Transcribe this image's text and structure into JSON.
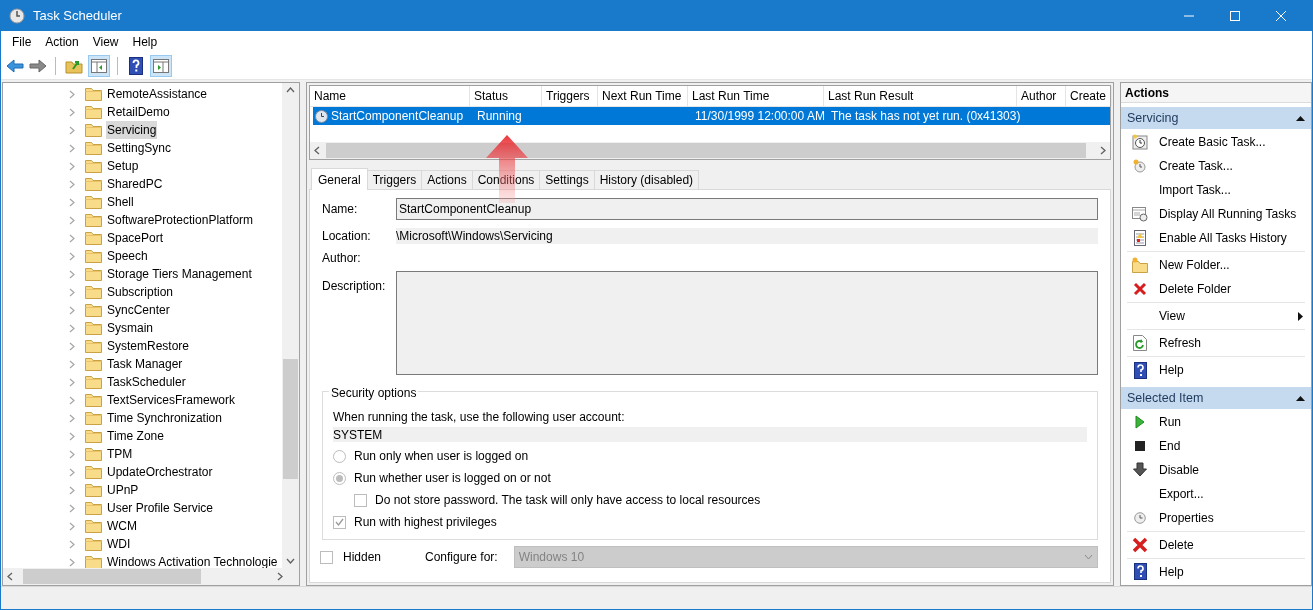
{
  "window": {
    "title": "Task Scheduler"
  },
  "menu": [
    "File",
    "Action",
    "View",
    "Help"
  ],
  "tree": {
    "items": [
      {
        "label": "RemoteAssistance",
        "selected": false
      },
      {
        "label": "RetailDemo",
        "selected": false
      },
      {
        "label": "Servicing",
        "selected": true
      },
      {
        "label": "SettingSync",
        "selected": false
      },
      {
        "label": "Setup",
        "selected": false
      },
      {
        "label": "SharedPC",
        "selected": false
      },
      {
        "label": "Shell",
        "selected": false
      },
      {
        "label": "SoftwareProtectionPlatform",
        "selected": false
      },
      {
        "label": "SpacePort",
        "selected": false
      },
      {
        "label": "Speech",
        "selected": false
      },
      {
        "label": "Storage Tiers Management",
        "selected": false
      },
      {
        "label": "Subscription",
        "selected": false
      },
      {
        "label": "SyncCenter",
        "selected": false
      },
      {
        "label": "Sysmain",
        "selected": false
      },
      {
        "label": "SystemRestore",
        "selected": false
      },
      {
        "label": "Task Manager",
        "selected": false
      },
      {
        "label": "TaskScheduler",
        "selected": false
      },
      {
        "label": "TextServicesFramework",
        "selected": false
      },
      {
        "label": "Time Synchronization",
        "selected": false
      },
      {
        "label": "Time Zone",
        "selected": false
      },
      {
        "label": "TPM",
        "selected": false
      },
      {
        "label": "UpdateOrchestrator",
        "selected": false
      },
      {
        "label": "UPnP",
        "selected": false
      },
      {
        "label": "User Profile Service",
        "selected": false
      },
      {
        "label": "WCM",
        "selected": false
      },
      {
        "label": "WDI",
        "selected": false
      },
      {
        "label": "Windows Activation Technologie",
        "selected": false
      }
    ]
  },
  "task_table": {
    "columns": [
      "Name",
      "Status",
      "Triggers",
      "Next Run Time",
      "Last Run Time",
      "Last Run Result",
      "Author",
      "Create"
    ],
    "rows": [
      {
        "selected": true,
        "cells": [
          "StartComponentCleanup",
          "Running",
          "",
          "",
          "11/30/1999 12:00:00 AM",
          "The task has not yet run. (0x41303)",
          "",
          ""
        ]
      }
    ]
  },
  "tabs": [
    {
      "label": "General",
      "selected": true
    },
    {
      "label": "Triggers",
      "selected": false
    },
    {
      "label": "Actions",
      "selected": false
    },
    {
      "label": "Conditions",
      "selected": false
    },
    {
      "label": "Settings",
      "selected": false
    },
    {
      "label": "History (disabled)",
      "selected": false
    }
  ],
  "general": {
    "name_label": "Name:",
    "name_value": "StartComponentCleanup",
    "location_label": "Location:",
    "location_value": "\\Microsoft\\Windows\\Servicing",
    "author_label": "Author:",
    "description_label": "Description:",
    "security": {
      "title": "Security options",
      "account_label": "When running the task, use the following user account:",
      "account_value": "SYSTEM",
      "options": [
        {
          "kind": "radio",
          "label": "Run only when user is logged on",
          "checked": false
        },
        {
          "kind": "radio",
          "label": "Run whether user is logged on or not",
          "checked": true,
          "children": [
            {
              "kind": "checkbox",
              "label": "Do not store password.  The task will only have access to local resources",
              "checked": false
            }
          ]
        },
        {
          "kind": "checkbox",
          "label": "Run with highest privileges",
          "checked": true
        }
      ]
    },
    "hidden": {
      "label": "Hidden",
      "checked": false
    },
    "configure": {
      "label": "Configure for:",
      "value": "Windows 10",
      "disabled": true
    }
  },
  "actions_pane": {
    "title": "Actions",
    "sections": [
      {
        "title": "Servicing",
        "expanded": true,
        "groups": [
          [
            {
              "label": "Create Basic Task..."
            },
            {
              "label": "Create Task..."
            },
            {
              "label": "Import Task..."
            },
            {
              "label": "Display All Running Tasks"
            },
            {
              "label": "Enable All Tasks History"
            }
          ],
          [
            {
              "label": "New Folder..."
            },
            {
              "label": "Delete Folder"
            }
          ],
          [
            {
              "label": "View",
              "submenu": true
            }
          ],
          [
            {
              "label": "Refresh"
            }
          ],
          [
            {
              "label": "Help"
            }
          ]
        ]
      },
      {
        "title": "Selected Item",
        "expanded": true,
        "groups": [
          [
            {
              "label": "Run"
            },
            {
              "label": "End"
            },
            {
              "label": "Disable"
            },
            {
              "label": "Export..."
            },
            {
              "label": "Properties"
            }
          ],
          [
            {
              "label": "Delete"
            }
          ],
          [
            {
              "label": "Help"
            }
          ]
        ]
      }
    ]
  }
}
